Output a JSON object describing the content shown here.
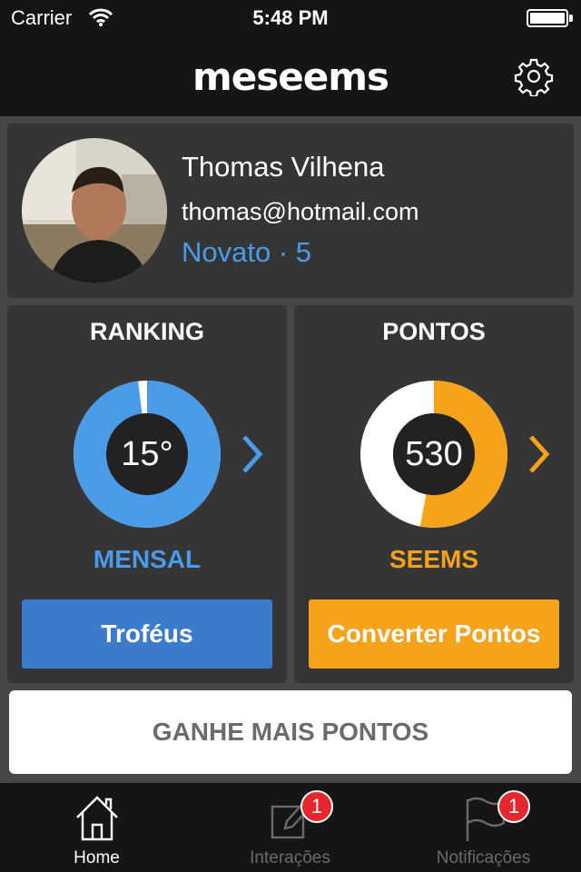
{
  "status_bar": {
    "carrier": "Carrier",
    "time": "5:48 PM"
  },
  "header": {
    "logo": "meseems",
    "settings_icon": "gear-icon"
  },
  "profile": {
    "name": "Thomas Vilhena",
    "email": "thomas@hotmail.com",
    "level": "Novato · 5"
  },
  "ranking": {
    "title": "RANKING",
    "value": "15°",
    "label": "MENSAL",
    "button": "Troféus",
    "progress": 0.98
  },
  "points": {
    "title": "PONTOS",
    "value": "530",
    "label": "SEEMS",
    "button": "Converter Pontos",
    "progress": 0.53
  },
  "earn_more": "GANHE MAIS PONTOS",
  "tabs": [
    {
      "label": "Home",
      "icon": "home-icon",
      "active": true
    },
    {
      "label": "Interações",
      "icon": "edit-icon",
      "badge": "1"
    },
    {
      "label": "Notificações",
      "icon": "flag-icon",
      "badge": "1"
    }
  ],
  "colors": {
    "accent_blue": "#4a9be8",
    "accent_orange": "#f7a21b",
    "badge_red": "#e8262f"
  }
}
